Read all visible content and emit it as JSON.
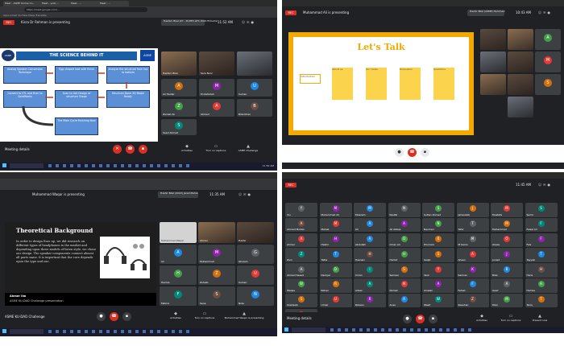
{
  "tl": {
    "tabs": [
      "Meet - ASME Online Co...",
      "Meet - ysrb-...",
      "Meet - ...",
      "Meet - ..."
    ],
    "url": "https://meet.google.com/...",
    "bookmarks": "Apps   Gmail   YouTube   Maps   Translate",
    "rec": "REC",
    "presenting": "Kisra Dr Rehman is presenting",
    "presenter_tag": "Hashim Bilal (ZY - DI-EE3-GTC 2022 ECharts)",
    "clock": "11:52 AM",
    "slide": {
      "title": "THE SCIENCE BEHIND IT",
      "logo_left": "ASME",
      "logo_right": "ASME",
      "boxes": [
        "Analog Speaker Conversion Technique",
        "Egg shaped look with finish",
        "Analyze the structure from top to bottom",
        "Structure Done 3D Model Ready",
        "Scan to Get Design of structure Shape",
        "Convert to STL and then to SolidWorks",
        "The Main Cycle Finishing Now"
      ]
    },
    "participants": [
      {
        "name": "Hashim Bilal",
        "init": "H",
        "color": "#5f6368"
      },
      {
        "name": "Sara Noor",
        "init": "",
        "color": "#5f6368"
      },
      {
        "name": "",
        "init": "",
        "color": "#5f6368"
      },
      {
        "name": "Ali Haider",
        "init": "A",
        "color": "#d56e0c"
      },
      {
        "name": "M Abdullah",
        "init": "M",
        "color": "#8e24aa"
      },
      {
        "name": "Usman",
        "init": "U",
        "color": "#1e88e5"
      },
      {
        "name": "Zainab Ali",
        "init": "Z",
        "color": "#43a047"
      },
      {
        "name": "Ahmed",
        "init": "A",
        "color": "#e53935"
      },
      {
        "name": "Bilal Khan",
        "init": "B",
        "color": "#6d4c41"
      },
      {
        "name": "Saad Ahmed",
        "init": "S",
        "color": "#00897b"
      }
    ],
    "meeting_details": "Meeting details",
    "actions": [
      "Activities",
      "Turn on captions",
      "ASME Challenge"
    ]
  },
  "tr": {
    "rec": "REC",
    "presenting": "Muhammad Ali is presenting",
    "presenter_tag": "Hashir Bilal (ASME) Hammad",
    "clock": "10:43 AM",
    "slide": {
      "title": "Let's Talk",
      "items": [
        "Introduction",
        "About us",
        "Our Goals",
        "Discussion",
        "Questions"
      ]
    },
    "tiles": [
      {
        "name": "",
        "cam": true
      },
      {
        "name": "",
        "cam": true
      },
      {
        "name": "A",
        "cam": false,
        "color": "#43a047"
      },
      {
        "name": "",
        "cam": true
      },
      {
        "name": "",
        "cam": true
      },
      {
        "name": "M",
        "cam": false,
        "color": "#e53935"
      },
      {
        "name": "",
        "cam": true
      },
      {
        "name": "",
        "cam": true
      },
      {
        "name": "S",
        "cam": false,
        "color": "#d56e0c"
      },
      {
        "name": "",
        "cam": true
      }
    ]
  },
  "bl": {
    "presenting": "Muhammad Waqar is presenting",
    "presenter_tag": "Hashir Bilal (2022) Jarad Mahal",
    "clock": "11:35 AM",
    "slide": {
      "title": "Theoretical Background",
      "body": "In order to design Ears up, we did research on different types of headphones in the market and depending upon three models of listen style, we chose our design. The speaker components connect almost all parts same. It is important that the core depends upon the type and use.",
      "caption_name": "Ahmer Ilm",
      "caption_text": "ASME KU-DAD Challenge presentation"
    },
    "participants": [
      {
        "name": "Muhammad Waqar",
        "init": "",
        "color": "#5f6368"
      },
      {
        "name": "Ahmer",
        "init": "",
        "color": "#5f6368"
      },
      {
        "name": "Hashir",
        "init": "",
        "color": "#5f6368"
      },
      {
        "name": "Ali",
        "init": "A",
        "color": "#1e88e5"
      },
      {
        "name": "Muhammad",
        "init": "M",
        "color": "#8e24aa"
      },
      {
        "name": "Ghulam",
        "init": "G",
        "color": "#5f6368"
      },
      {
        "name": "Hamza",
        "init": "H",
        "color": "#43a047"
      },
      {
        "name": "Zohaib",
        "init": "Z",
        "color": "#d56e0c"
      },
      {
        "name": "Usman",
        "init": "U",
        "color": "#e53935"
      },
      {
        "name": "Fatima",
        "init": "F",
        "color": "#00897b"
      },
      {
        "name": "Sana",
        "init": "S",
        "color": "#6d4c41"
      },
      {
        "name": "Nida",
        "init": "N",
        "color": "#1e88e5"
      }
    ],
    "meeting_details": "ASME KU-DAD Challenge",
    "actions": [
      "Activities",
      "Turn on captions",
      "Muhammad Waqar is presenting"
    ]
  },
  "br": {
    "rec": "REC",
    "clock": "11:45 AM",
    "grid": [
      {
        "name": "You",
        "init": "Y",
        "color": "#5f6368"
      },
      {
        "name": "Muhammad Ali",
        "init": "M",
        "color": "#8e24aa"
      },
      {
        "name": "Moazam",
        "init": "M",
        "color": "#1e88e5"
      },
      {
        "name": "Naufal",
        "init": "N",
        "color": "#5f6368"
      },
      {
        "name": "Sultan Ahmed",
        "init": "S",
        "color": "#43a047"
      },
      {
        "name": "Jahanzaib",
        "init": "J",
        "color": "#d56e0c"
      },
      {
        "name": "Mustafa",
        "init": "M",
        "color": "#e53935"
      },
      {
        "name": "Samir",
        "init": "S",
        "color": "#00897b"
      },
      {
        "name": "Ahmed Mohsin",
        "init": "A",
        "color": "#6d4c41"
      },
      {
        "name": "Mehak",
        "init": "M",
        "color": "#e53935"
      },
      {
        "name": "Ali",
        "init": "A",
        "color": "#1e88e5"
      },
      {
        "name": "Ali Abbas",
        "init": "A",
        "color": "#8e24aa"
      },
      {
        "name": "Nauman",
        "init": "N",
        "color": "#43a047"
      },
      {
        "name": "Tahir",
        "init": "T",
        "color": "#5f6368"
      },
      {
        "name": "Muhammad",
        "init": "M",
        "color": "#d56e0c"
      },
      {
        "name": "Faisal Ali",
        "init": "F",
        "color": "#00897b"
      },
      {
        "name": "Ahmer",
        "init": "A",
        "color": "#e53935"
      },
      {
        "name": "Hashir",
        "init": "H",
        "color": "#8e24aa"
      },
      {
        "name": "Abdullah",
        "init": "A",
        "color": "#1e88e5"
      },
      {
        "name": "Omer Ali",
        "init": "O",
        "color": "#43a047"
      },
      {
        "name": "Khurram",
        "init": "K",
        "color": "#d56e0c"
      },
      {
        "name": "M Sarim",
        "init": "M",
        "color": "#5f6368"
      },
      {
        "name": "Owais",
        "init": "O",
        "color": "#e53935"
      },
      {
        "name": "Faiz",
        "init": "F",
        "color": "#8e24aa"
      },
      {
        "name": "Zain",
        "init": "Z",
        "color": "#00897b"
      },
      {
        "name": "Talha",
        "init": "T",
        "color": "#1e88e5"
      },
      {
        "name": "Hasnain",
        "init": "H",
        "color": "#6d4c41"
      },
      {
        "name": "Hamid",
        "init": "H",
        "color": "#43a047"
      },
      {
        "name": "Saqib",
        "init": "S",
        "color": "#d56e0c"
      },
      {
        "name": "Ahsan",
        "init": "A",
        "color": "#e53935"
      },
      {
        "name": "Junaid",
        "init": "J",
        "color": "#8e24aa"
      },
      {
        "name": "Tayyab",
        "init": "T",
        "color": "#1e88e5"
      },
      {
        "name": "Ahmed Saeed",
        "init": "A",
        "color": "#5f6368"
      },
      {
        "name": "Daniyal",
        "init": "D",
        "color": "#43a047"
      },
      {
        "name": "Imran",
        "init": "I",
        "color": "#00897b"
      },
      {
        "name": "Sameer",
        "init": "S",
        "color": "#d56e0c"
      },
      {
        "name": "Yasir",
        "init": "Y",
        "color": "#e53935"
      },
      {
        "name": "Kamran",
        "init": "K",
        "color": "#8e24aa"
      },
      {
        "name": "Bilal",
        "init": "B",
        "color": "#1e88e5"
      },
      {
        "name": "Haris",
        "init": "H",
        "color": "#6d4c41"
      },
      {
        "name": "Waqas",
        "init": "W",
        "color": "#43a047"
      },
      {
        "name": "Rehan",
        "init": "R",
        "color": "#d56e0c"
      },
      {
        "name": "Adeel",
        "init": "A",
        "color": "#00897b"
      },
      {
        "name": "Noman",
        "init": "N",
        "color": "#e53935"
      },
      {
        "name": "Arsalan",
        "init": "A",
        "color": "#8e24aa"
      },
      {
        "name": "Fahad",
        "init": "F",
        "color": "#1e88e5"
      },
      {
        "name": "Asad",
        "init": "A",
        "color": "#5f6368"
      },
      {
        "name": "Hamza",
        "init": "H",
        "color": "#43a047"
      },
      {
        "name": "Shahzaib",
        "init": "S",
        "color": "#d56e0c"
      },
      {
        "name": "Umair",
        "init": "U",
        "color": "#e53935"
      },
      {
        "name": "Rizwan",
        "init": "R",
        "color": "#8e24aa"
      },
      {
        "name": "Anas",
        "init": "A",
        "color": "#1e88e5"
      },
      {
        "name": "Wasif",
        "init": "W",
        "color": "#00897b"
      },
      {
        "name": "Zeeshan",
        "init": "Z",
        "color": "#6d4c41"
      },
      {
        "name": "Moiz",
        "init": "M",
        "color": "#43a047"
      },
      {
        "name": "Tariq",
        "init": "T",
        "color": "#d56e0c"
      },
      {
        "name": "Azhar",
        "init": "A",
        "color": "#e53935"
      }
    ],
    "meeting_details": "Meeting details",
    "actions": [
      "Activities",
      "Turn on captions",
      "Present now"
    ]
  },
  "taskbar_time": "11:52 AM"
}
